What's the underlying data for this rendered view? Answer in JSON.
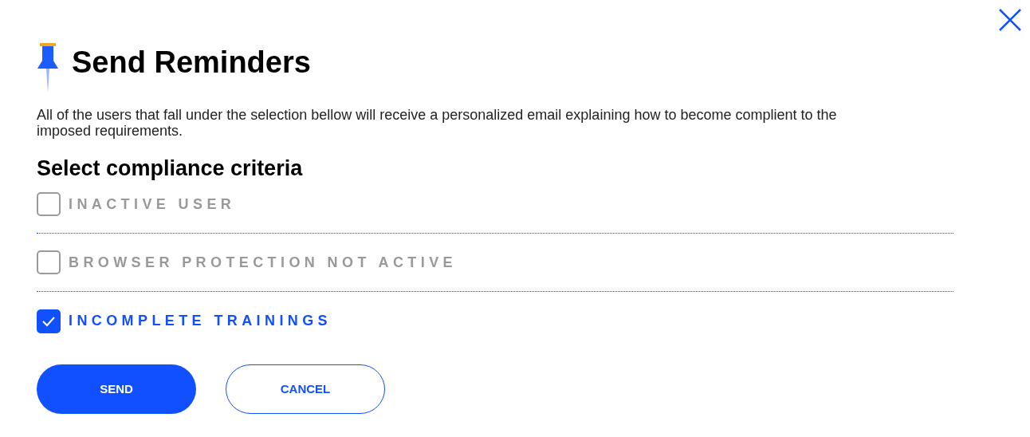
{
  "title": "Send Reminders",
  "description": "All of the users that fall under the selection bellow will receive a personalized email explaining how to become complient to the imposed requirements.",
  "section_title": "Select compliance criteria",
  "criteria": [
    {
      "label": "INACTIVE USER",
      "checked": false
    },
    {
      "label": "BROWSER PROTECTION NOT ACTIVE",
      "checked": false
    },
    {
      "label": "INCOMPLETE TRAININGS",
      "checked": true
    }
  ],
  "buttons": [
    {
      "label": "SEND",
      "kind": "primary"
    },
    {
      "label": "CANCEL",
      "kind": "secondary"
    }
  ]
}
